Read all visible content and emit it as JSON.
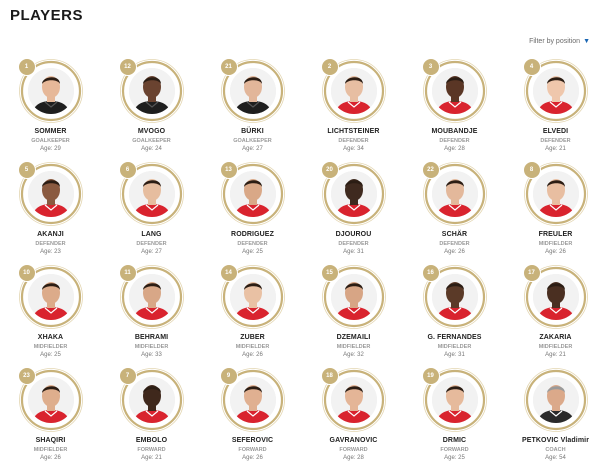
{
  "page": {
    "title": "PLAYERS",
    "filter_label": "Filter by position",
    "filter_arrow": "▼"
  },
  "age_prefix": "Age: ",
  "colors": {
    "ring": "#c8b27a",
    "number_badge": "#c8b27a",
    "kit_red": "#d9232e",
    "gk_kit": "#1e1e1e",
    "filter_arrow": "#1a66b3"
  },
  "players": [
    {
      "number": "1",
      "name": "SOMMER",
      "position": "GOALKEEPER",
      "age": "29",
      "kit": "gk",
      "skin": "#e6b899"
    },
    {
      "number": "12",
      "name": "MVOGO",
      "position": "GOALKEEPER",
      "age": "24",
      "kit": "gk",
      "skin": "#6a4330"
    },
    {
      "number": "21",
      "name": "BÜRKI",
      "position": "GOALKEEPER",
      "age": "27",
      "kit": "gk",
      "skin": "#e2b69a"
    },
    {
      "number": "2",
      "name": "LICHTSTEINER",
      "position": "DEFENDER",
      "age": "34",
      "kit": "red",
      "skin": "#e7bea2"
    },
    {
      "number": "3",
      "name": "MOUBANDJE",
      "position": "DEFENDER",
      "age": "28",
      "kit": "red",
      "skin": "#5a3625"
    },
    {
      "number": "4",
      "name": "ELVEDI",
      "position": "DEFENDER",
      "age": "21",
      "kit": "red",
      "skin": "#efc7ac"
    },
    {
      "number": "5",
      "name": "AKANJI",
      "position": "DEFENDER",
      "age": "23",
      "kit": "red",
      "skin": "#8a5a40"
    },
    {
      "number": "6",
      "name": "LANG",
      "position": "DEFENDER",
      "age": "27",
      "kit": "red",
      "skin": "#e6bd9f"
    },
    {
      "number": "13",
      "name": "RODRIGUEZ",
      "position": "DEFENDER",
      "age": "25",
      "kit": "red",
      "skin": "#d9a887"
    },
    {
      "number": "20",
      "name": "DJOUROU",
      "position": "DEFENDER",
      "age": "31",
      "kit": "red",
      "skin": "#3f2a1f"
    },
    {
      "number": "22",
      "name": "SCHÄR",
      "position": "DEFENDER",
      "age": "26",
      "kit": "red",
      "skin": "#e3b89b"
    },
    {
      "number": "8",
      "name": "FREULER",
      "position": "MIDFIELDER",
      "age": "26",
      "kit": "red",
      "skin": "#e8bea1"
    },
    {
      "number": "10",
      "name": "XHAKA",
      "position": "MIDFIELDER",
      "age": "25",
      "kit": "red",
      "skin": "#dcab8a"
    },
    {
      "number": "11",
      "name": "BEHRAMI",
      "position": "MIDFIELDER",
      "age": "33",
      "kit": "red",
      "skin": "#d8a787"
    },
    {
      "number": "14",
      "name": "ZUBER",
      "position": "MIDFIELDER",
      "age": "26",
      "kit": "red",
      "skin": "#e9c1a4"
    },
    {
      "number": "15",
      "name": "DZEMAILI",
      "position": "MIDFIELDER",
      "age": "32",
      "kit": "red",
      "skin": "#d7a585"
    },
    {
      "number": "16",
      "name": "G. FERNANDES",
      "position": "MIDFIELDER",
      "age": "31",
      "kit": "red",
      "skin": "#5b3a28"
    },
    {
      "number": "17",
      "name": "ZAKARIA",
      "position": "MIDFIELDER",
      "age": "21",
      "kit": "red",
      "skin": "#4a2f21"
    },
    {
      "number": "23",
      "name": "SHAQIRI",
      "position": "MIDFIELDER",
      "age": "26",
      "kit": "red",
      "skin": "#deae8d"
    },
    {
      "number": "7",
      "name": "EMBOLO",
      "position": "FORWARD",
      "age": "21",
      "kit": "red",
      "skin": "#3f281c"
    },
    {
      "number": "9",
      "name": "SEFEROVIC",
      "position": "FORWARD",
      "age": "26",
      "kit": "red",
      "skin": "#e0b091"
    },
    {
      "number": "18",
      "name": "GAVRANOVIC",
      "position": "FORWARD",
      "age": "28",
      "kit": "red",
      "skin": "#e4b597"
    },
    {
      "number": "19",
      "name": "DRMIC",
      "position": "FORWARD",
      "age": "25",
      "kit": "red",
      "skin": "#e6ba9c"
    },
    {
      "number": "",
      "name": "PETKOVIC Vladimir",
      "position": "COACH",
      "age": "54",
      "kit": "suit",
      "skin": "#dba98a"
    }
  ]
}
